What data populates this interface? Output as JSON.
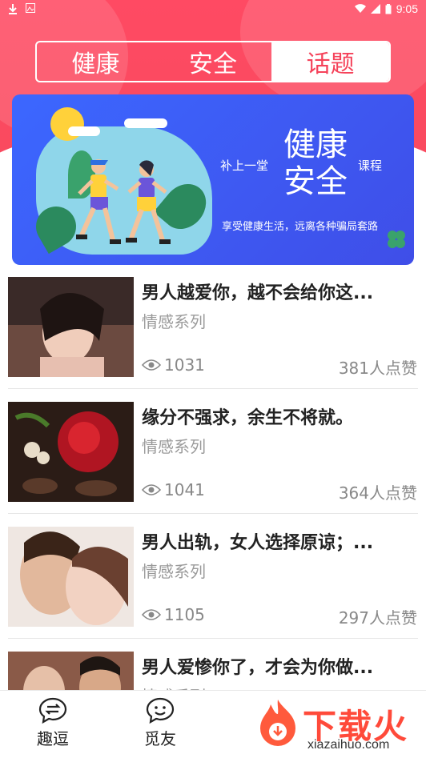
{
  "status_bar": {
    "time": "9:05"
  },
  "tabs": [
    {
      "label": "健康",
      "active": false
    },
    {
      "label": "安全",
      "active": false
    },
    {
      "label": "话题",
      "active": true
    }
  ],
  "banner": {
    "left_text": "补上一堂",
    "big_line1": "健康",
    "big_line2": "安全",
    "right_text": "课程",
    "tagline": "享受健康生活，远离各种骗局套路"
  },
  "articles": [
    {
      "title": "男人越爱你，越不会给你这...",
      "category": "情感系列",
      "views": "1031",
      "likes": "381人点赞"
    },
    {
      "title": "缘分不强求，余生不将就。",
      "category": "情感系列",
      "views": "1041",
      "likes": "364人点赞"
    },
    {
      "title": "男人出轨，女人选择原谅；...",
      "category": "情感系列",
      "views": "1105",
      "likes": "297人点赞"
    },
    {
      "title": "男人爱惨你了，才会为你做...",
      "category": "情感系列",
      "views": "",
      "likes": ""
    }
  ],
  "bottom_nav": [
    {
      "label": "趣逗",
      "icon": "swap-chat-icon"
    },
    {
      "label": "觅友",
      "icon": "smile-chat-icon"
    }
  ],
  "watermark": {
    "text": "下载火",
    "domain": "xiazaihuo.com"
  },
  "colors": {
    "accent": "#f5425a",
    "banner_blue": "#3c67ff",
    "muted": "#9a9a9a"
  }
}
